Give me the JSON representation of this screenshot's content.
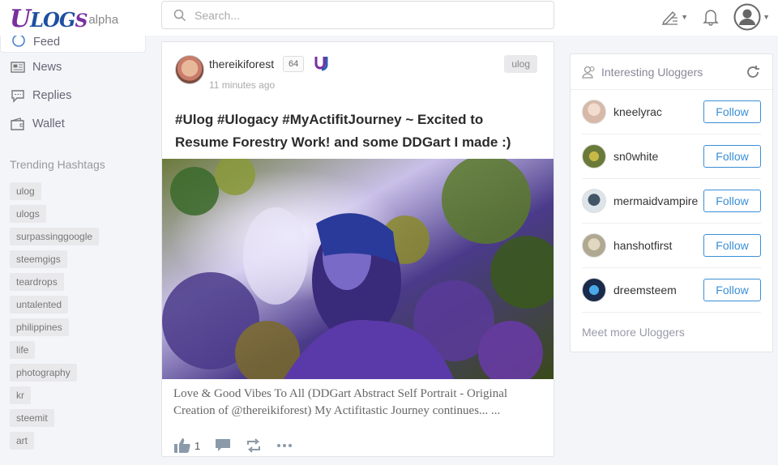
{
  "header": {
    "logo_text": "ULOGS",
    "logo_sub": "alpha",
    "search_placeholder": "Search..."
  },
  "sidebar": {
    "items": [
      {
        "label": "Feed",
        "icon": "feed-icon"
      },
      {
        "label": "News",
        "icon": "news-icon"
      },
      {
        "label": "Replies",
        "icon": "replies-icon"
      },
      {
        "label": "Wallet",
        "icon": "wallet-icon"
      }
    ],
    "trending_title": "Trending Hashtags",
    "tags": [
      "ulog",
      "ulogs",
      "surpassinggoogle",
      "steemgigs",
      "teardrops",
      "untalented",
      "philippines",
      "life",
      "photography",
      "kr",
      "steemit",
      "art"
    ]
  },
  "post": {
    "author": "thereikiforest",
    "reputation": "64",
    "time": "11 minutes ago",
    "tag": "ulog",
    "title": "#Ulog #Ulogacy #MyActifitJourney ~ Excited to Resume Forestry Work! and some DDGart I made :)",
    "excerpt": "Love & Good Vibes To All (DDGart Abstract Self Portrait - Original Creation of @thereikiforest) My Actifitastic Journey continues... ...",
    "likes": "1"
  },
  "panel": {
    "title": "Interesting Uloggers",
    "follow_label": "Follow",
    "users": [
      {
        "name": "kneelyrac",
        "color": "#d8b8a8"
      },
      {
        "name": "sn0white",
        "color": "#6a7a3a"
      },
      {
        "name": "mermaidvampire",
        "color": "#8899aa"
      },
      {
        "name": "hanshotfirst",
        "color": "#b0a890"
      },
      {
        "name": "dreemsteem",
        "color": "#2a3a5a"
      }
    ],
    "meet_more": "Meet more Uloggers"
  },
  "colors": {
    "accent": "#3a8fd6",
    "background": "#f4f5f8"
  }
}
